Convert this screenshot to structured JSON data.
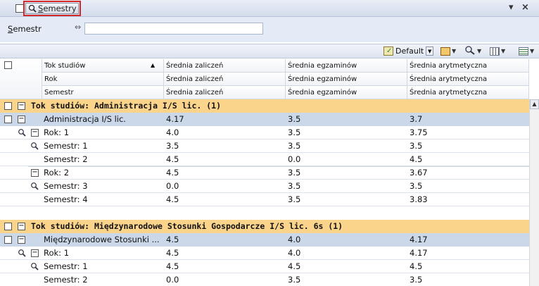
{
  "titlebar": {
    "button_label_accel": "S",
    "button_label_rest": "emestry",
    "pin_glyph": "▾",
    "close_glyph": "×"
  },
  "filter": {
    "label_accel": "S",
    "label_rest": "emestr",
    "op_glyph": "⇔",
    "value": ""
  },
  "toolbar": {
    "layout_label": "Default"
  },
  "columns": {
    "row1": [
      "Tok studiów",
      "Średnia zaliczeń",
      "Średnia egzaminów",
      "Średnia arytmetyczna"
    ],
    "row2": [
      "Rok",
      "Średnia zaliczeń",
      "Średnia egzaminów",
      "Średnia arytmetyczna"
    ],
    "row3": [
      "Semestr",
      "Średnia zaliczeń",
      "Średnia egzaminów",
      "Średnia arytmetyczna"
    ]
  },
  "rows": [
    {
      "kind": "group",
      "text": "Tok studiów: Administracja I/S lic.  (1)"
    },
    {
      "kind": "tok",
      "name": "Administracja I/S lic.",
      "z": "4.17",
      "e": "3.5",
      "a": "3.7"
    },
    {
      "kind": "rok",
      "name": "Rok: 1",
      "z": "4.0",
      "e": "3.5",
      "a": "3.75"
    },
    {
      "kind": "sem",
      "mag": true,
      "name": "Semestr: 1",
      "z": "3.5",
      "e": "3.5",
      "a": "3.5"
    },
    {
      "kind": "sem",
      "mag": false,
      "name": "Semestr: 2",
      "z": "4.5",
      "e": "0.0",
      "a": "4.5"
    },
    {
      "kind": "rok2",
      "name": "Rok: 2",
      "z": "4.5",
      "e": "3.5",
      "a": "3.67"
    },
    {
      "kind": "sem",
      "mag": true,
      "name": "Semestr: 3",
      "z": "0.0",
      "e": "3.5",
      "a": "3.5"
    },
    {
      "kind": "sem",
      "mag": false,
      "name": "Semestr: 4",
      "z": "4.5",
      "e": "3.5",
      "a": "3.83"
    },
    {
      "kind": "blank"
    },
    {
      "kind": "group",
      "text": "Tok studiów: Międzynarodowe Stosunki Gospodarcze I/S lic. 6s  (1)"
    },
    {
      "kind": "tok",
      "name": "Międzynarodowe Stosunki ...",
      "z": "4.5",
      "e": "4.0",
      "a": "4.17"
    },
    {
      "kind": "rok",
      "name": "Rok: 1",
      "z": "4.5",
      "e": "4.0",
      "a": "4.17"
    },
    {
      "kind": "sem",
      "mag": true,
      "name": "Semestr: 1",
      "z": "4.5",
      "e": "4.5",
      "a": "4.5"
    },
    {
      "kind": "sem",
      "mag": false,
      "name": "Semestr: 2",
      "z": "0.0",
      "e": "3.5",
      "a": "3.5"
    }
  ],
  "colors": {
    "group_bg": "#fbd48c",
    "tok_bg": "#cbd8ea",
    "highlight": "#d3282a"
  }
}
